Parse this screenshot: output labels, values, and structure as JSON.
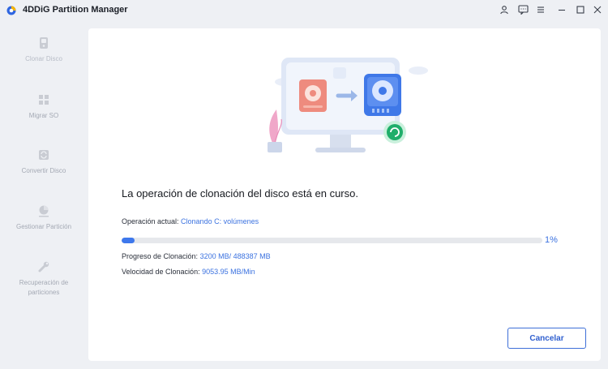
{
  "app": {
    "title": "4DDiG Partition Manager"
  },
  "window_controls": [
    "user-icon",
    "feedback-icon",
    "menu-icon",
    "minimize-icon",
    "maximize-icon",
    "close-icon"
  ],
  "sidebar": {
    "items": [
      {
        "label": "Clonar Disco",
        "icon": "disk-clone-icon",
        "active": true
      },
      {
        "label": "Migrar SO",
        "icon": "os-migrate-icon",
        "active": false
      },
      {
        "label": "Convertir Disco",
        "icon": "disk-convert-icon",
        "active": false
      },
      {
        "label": "Gestionar Partición",
        "icon": "partition-pie-icon",
        "active": false
      },
      {
        "label": "Recuperación de particiones",
        "icon": "wrench-icon",
        "active": false
      }
    ]
  },
  "main": {
    "heading": "La operación de clonación del disco está en curso.",
    "operation_label": "Operación actual: ",
    "operation_value": "Clonando C: volúmenes",
    "progress_fraction": 0.01,
    "progress_text": "1%",
    "clone_progress_label": "Progreso de Clonación: ",
    "clone_progress_value": "3200 MB/ 488387 MB",
    "clone_speed_label": "Velocidad de Clonación: ",
    "clone_speed_value": "9053.95 MB/Min",
    "cancel_label": "Cancelar"
  },
  "colors": {
    "accent": "#3e78ec",
    "background": "#eef0f4",
    "card": "#ffffff"
  }
}
